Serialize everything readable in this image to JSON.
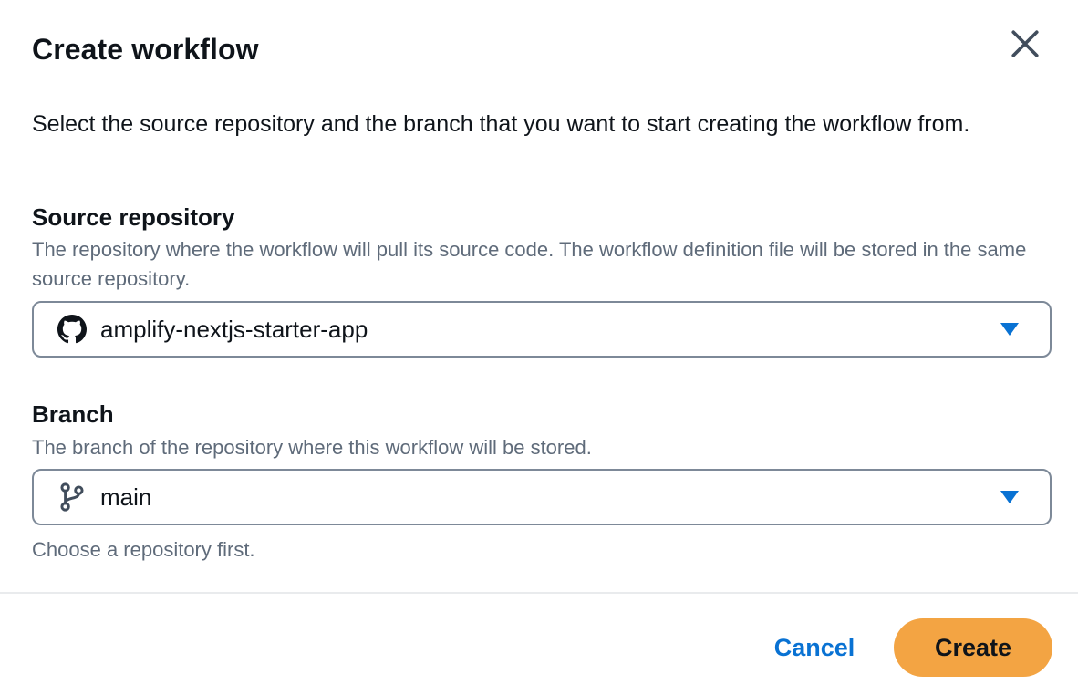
{
  "modal": {
    "title": "Create workflow",
    "close_icon": "close-icon",
    "intro": "Select the source repository and the branch that you want to start creating the workflow from."
  },
  "source_repository": {
    "label": "Source repository",
    "description": "The repository where the workflow will pull its source code. The workflow definition file will be stored in the same source repository.",
    "value": "amplify-nextjs-starter-app",
    "icon": "github-icon"
  },
  "branch": {
    "label": "Branch",
    "description": "The branch of the repository where this workflow will be stored.",
    "value": "main",
    "icon": "git-branch-icon",
    "constraint": "Choose a repository first."
  },
  "footer": {
    "cancel_label": "Cancel",
    "create_label": "Create"
  },
  "colors": {
    "primary_button": "#f3a443",
    "link": "#0972d3",
    "caret": "#0972d3",
    "border": "#7d8998",
    "secondary_text": "#5f6b7a"
  }
}
